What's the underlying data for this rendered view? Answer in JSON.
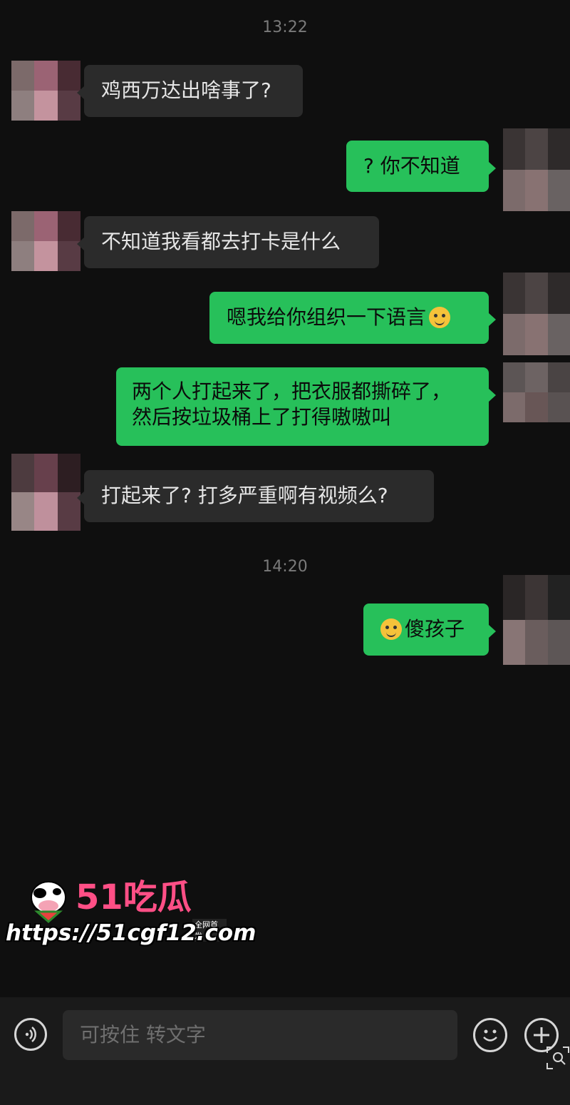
{
  "messages": {
    "timestamp1": "13:22",
    "timestamp2": "14:20",
    "m1": "鸡西万达出啥事了?",
    "m2": "? 你不知道",
    "m3": "不知道我看都去打卡是什么",
    "m4": "嗯我给你组织一下语言",
    "m4_icon": "doge-emoji-icon",
    "m5_line1": "两个人打起来了，把衣服都撕碎了，",
    "m5_line2": "然后按垃圾桶上了打得嗷嗷叫",
    "m6": "打起来了? 打多严重啊有视频么?",
    "m7": "傻孩子",
    "m7_icon": "laughing-crying-emoji-icon"
  },
  "input_bar": {
    "placeholder": "可按住 转文字",
    "voice_icon": "voice-icon",
    "emoji_icon": "emoji-icon",
    "plus_icon": "plus-icon"
  },
  "watermark": {
    "brand": "51吃瓜",
    "badge": "全网首发",
    "url": "https://51cgf12.com"
  },
  "colors": {
    "background": "#0f0f0f",
    "sent_bubble": "#27c05a",
    "received_bubble": "#2b2b2b",
    "watermark_pink": "#ff4f86"
  }
}
